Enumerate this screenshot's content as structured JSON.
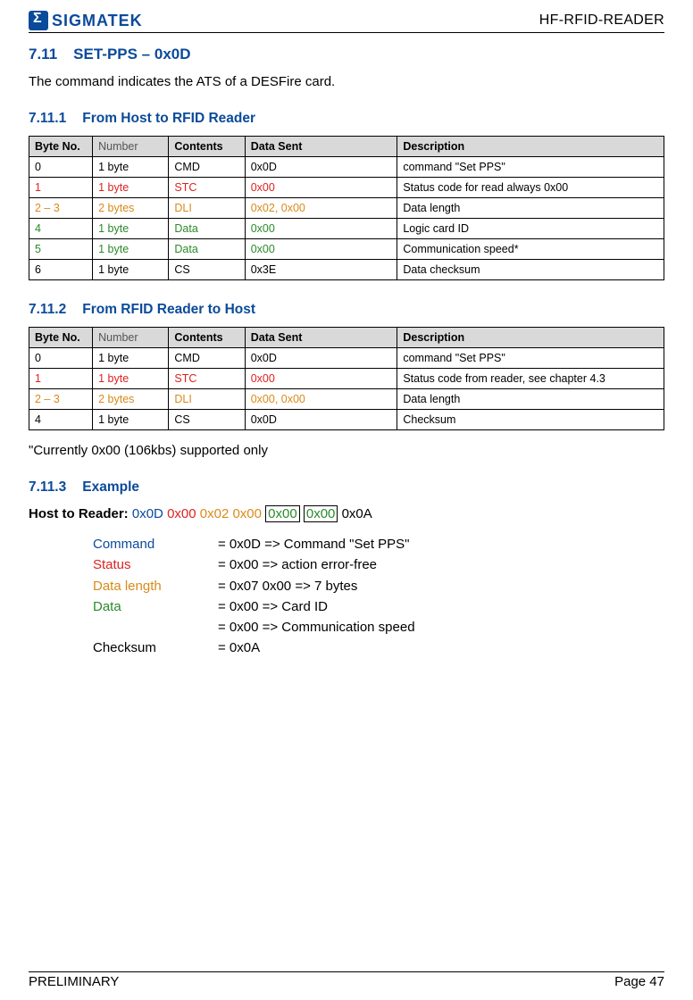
{
  "header": {
    "logo_text": "SIGMATEK",
    "doc_title": "HF-RFID-READER"
  },
  "section_main": {
    "number": "7.11",
    "title": "SET-PPS – 0x0D",
    "intro": "The command indicates the ATS of a DESFire card."
  },
  "sub1": {
    "number": "7.11.1",
    "title": "From Host to RFID Reader"
  },
  "table_headers": {
    "byte_no": "Byte No.",
    "number": "Number",
    "contents": "Contents",
    "data_sent": "Data Sent",
    "description": "Description"
  },
  "table1": [
    {
      "bn": "0",
      "num": "1 byte",
      "con": "CMD",
      "ds": "0x0D",
      "desc": "command \"Set PPS\"",
      "cls": ""
    },
    {
      "bn": "1",
      "num": "1 byte",
      "con": "STC",
      "ds": "0x00",
      "desc": "Status code for read always 0x00",
      "cls": "c-red"
    },
    {
      "bn": "2 – 3",
      "num": "2 bytes",
      "con": "DLI",
      "ds": "0x02, 0x00",
      "desc": "Data length",
      "cls": "c-orange"
    },
    {
      "bn": "4",
      "num": "1 byte",
      "con": "Data",
      "ds": "0x00",
      "desc": "Logic card ID",
      "cls": "c-green"
    },
    {
      "bn": "5",
      "num": "1 byte",
      "con": "Data",
      "ds": "0x00",
      "desc": "Communication speed*",
      "cls": "c-green"
    },
    {
      "bn": "6",
      "num": "1 byte",
      "con": "CS",
      "ds": "0x3E",
      "desc": "Data checksum",
      "cls": ""
    }
  ],
  "sub2": {
    "number": "7.11.2",
    "title": "From RFID Reader to Host"
  },
  "table2": [
    {
      "bn": "0",
      "num": "1 byte",
      "con": "CMD",
      "ds": "0x0D",
      "desc": "command \"Set PPS\"",
      "cls": ""
    },
    {
      "bn": "1",
      "num": "1 byte",
      "con": "STC",
      "ds": "0x00",
      "desc": "Status code from reader, see chapter 4.3",
      "cls": "c-red"
    },
    {
      "bn": "2 – 3",
      "num": "2 bytes",
      "con": "DLI",
      "ds": "0x00, 0x00",
      "desc": "Data length",
      "cls": "c-orange"
    },
    {
      "bn": "4",
      "num": "1 byte",
      "con": "CS",
      "ds": "0x0D",
      "desc": "Checksum",
      "cls": ""
    }
  ],
  "footnote": "\"Currently 0x00 (106kbs) supported only",
  "sub3": {
    "number": "7.11.3",
    "title": "Example"
  },
  "example": {
    "lead": "Host to Reader:",
    "hx": {
      "b1": "0x0D",
      "b2": "0x00",
      "b3": "0x02",
      "b4": "0x00",
      "b5": "0x00",
      "b6": "0x00",
      "b7": "0x0A"
    }
  },
  "legend": {
    "command_lbl": "Command",
    "command_val": "= 0x0D => Command \"Set PPS\"",
    "status_lbl": "Status",
    "status_val": "= 0x00 => action error-free",
    "datalen_lbl": "Data length",
    "datalen_val": "= 0x07 0x00 => 7 bytes",
    "data_lbl": "Data",
    "data_val1": "= 0x00 => Card ID",
    "data_val2": "= 0x00 => Communication speed",
    "checksum_lbl": "Checksum",
    "checksum_val": "= 0x0A"
  },
  "footer": {
    "left": "PRELIMINARY",
    "right": "Page 47"
  }
}
